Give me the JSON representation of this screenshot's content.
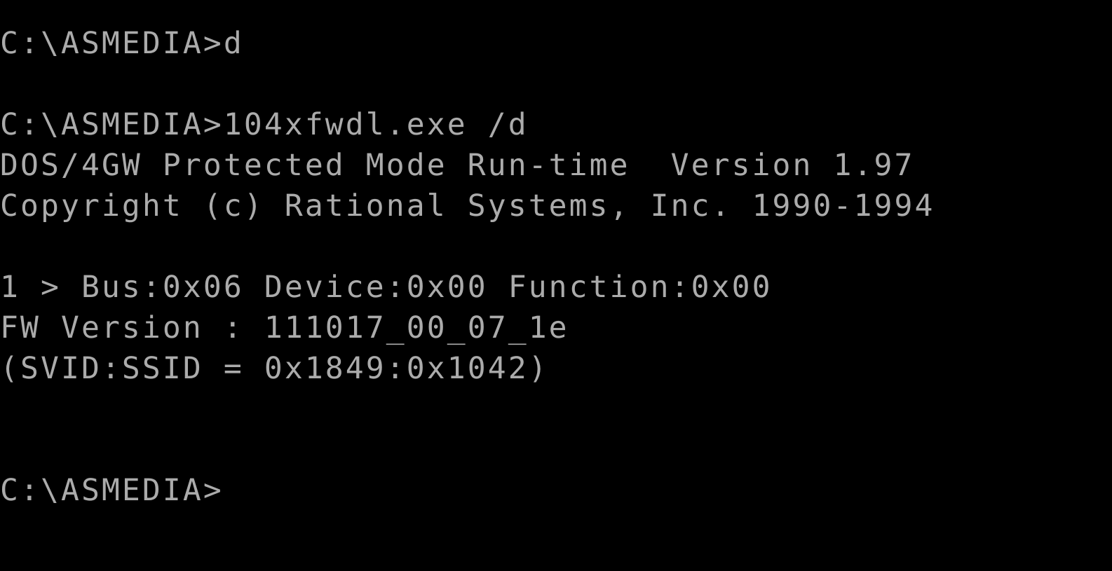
{
  "terminal": {
    "title": "C:\\ASMEDIA",
    "background_color": "#000000",
    "text_color": "#ababab",
    "columns": 54,
    "rows": 14,
    "lines": [
      {
        "id": "line-1",
        "text": "C:\\ASMEDIA>d",
        "kind": "prompt-command"
      },
      {
        "id": "line-2",
        "text": "",
        "kind": "blank"
      },
      {
        "id": "line-3",
        "text": "C:\\ASMEDIA>104xfwdl.exe /d",
        "kind": "prompt-command"
      },
      {
        "id": "line-4",
        "text": "DOS/4GW Protected Mode Run-time  Version 1.97",
        "kind": "banner"
      },
      {
        "id": "line-5",
        "text": "Copyright (c) Rational Systems, Inc. 1990-1994",
        "kind": "banner"
      },
      {
        "id": "line-6",
        "text": "",
        "kind": "blank"
      },
      {
        "id": "line-7",
        "text": "1 > Bus:0x06 Device:0x00 Function:0x00",
        "kind": "device-output"
      },
      {
        "id": "line-8",
        "text": "FW Version : 111017_00_07_1e",
        "kind": "device-output"
      },
      {
        "id": "line-9",
        "text": "(SVID:SSID = 0x1849:0x1042)",
        "kind": "device-output"
      },
      {
        "id": "line-10",
        "text": "",
        "kind": "blank"
      },
      {
        "id": "line-11",
        "text": "",
        "kind": "blank"
      },
      {
        "id": "line-12",
        "text": "C:\\ASMEDIA>",
        "kind": "prompt"
      }
    ],
    "command_entered": "104xfwdl.exe /d",
    "prompt_string": "C:\\ASMEDIA>",
    "dos_extender": {
      "name": "DOS/4GW Protected Mode Run-time",
      "version": "1.97",
      "copyright": "Copyright (c) Rational Systems, Inc. 1990-1994"
    },
    "device_info": {
      "index": "1",
      "bus": "0x06",
      "device": "0x00",
      "function": "0x00",
      "fw_version": "111017_00_07_1e",
      "svid": "0x1849",
      "ssid": "0x1042"
    }
  }
}
